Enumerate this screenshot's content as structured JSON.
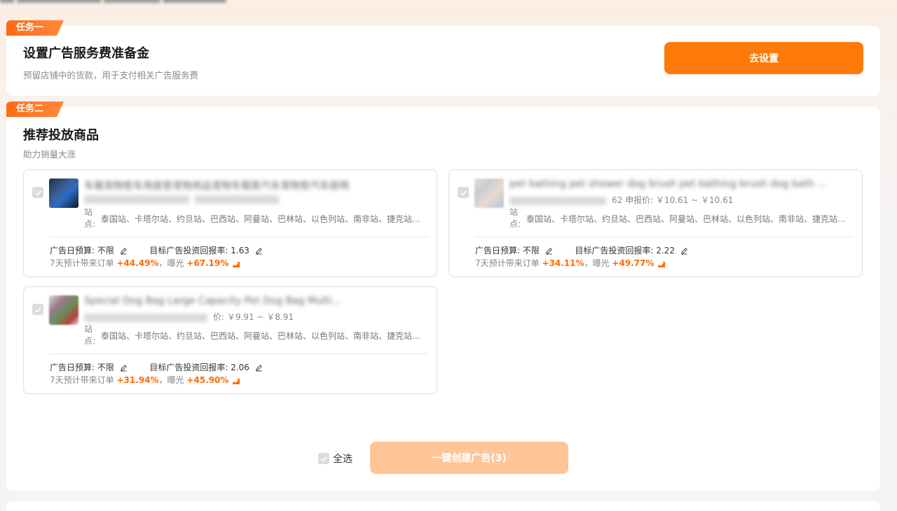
{
  "task1": {
    "ribbon": "任务一",
    "title": "设置广告服务费准备金",
    "subtitle": "预留店铺中的货款，用于支付相关广告服务费",
    "button_label": "去设置"
  },
  "task2": {
    "ribbon": "任务二",
    "title": "推荐投放商品",
    "subtitle": "助力销量大涨",
    "products": [
      {
        "title": "车载宠物垫车用座垫宠物用品宠物车载垫汽车宠物垫汽车座椅",
        "meta": "",
        "sites_label": "站点:",
        "sites": "泰国站、卡塔尔站、约旦站、巴西站、阿曼站、巴林站、以色列站、南非站、捷克站...",
        "budget_label": "广告日预算: 不限",
        "roi_label": "目标广告投资回报率: 1.63",
        "forecast_prefix": "7天预计带来订单",
        "orders_pct": "+44.49%",
        "forecast_mid": "，曝光",
        "exposure_pct": "+67.19%"
      },
      {
        "title": "pet bathing pet shower dog brush pet bathing brush dog bath ...",
        "meta": "62   申报价: ￥10.61 ~ ￥10.61",
        "sites_label": "站点:",
        "sites": "泰国站、卡塔尔站、约旦站、巴西站、阿曼站、巴林站、以色列站、南非站、捷克站...",
        "budget_label": "广告日预算: 不限",
        "roi_label": "目标广告投资回报率: 2.22",
        "forecast_prefix": "7天预计带来订单",
        "orders_pct": "+34.11%",
        "forecast_mid": "，曝光",
        "exposure_pct": "+49.77%"
      },
      {
        "title": "Special Dog Bag Large Capacity Pet Dog Bag Multi...",
        "meta": "价: ￥9.91 ~ ￥8.91",
        "sites_label": "站点:",
        "sites": "泰国站、卡塔尔站、约旦站、巴西站、阿曼站、巴林站、以色列站、南非站、捷克站...",
        "budget_label": "广告日预算: 不限",
        "roi_label": "目标广告投资回报率: 2.06",
        "forecast_prefix": "7天预计带来订单",
        "orders_pct": "+31.94%",
        "forecast_mid": "，曝光",
        "exposure_pct": "+45.90%"
      }
    ],
    "select_all_label": "全选",
    "create_button_label": "一键创建广告(3)"
  },
  "colors": {
    "accent": "#ff7a0a",
    "highlight": "#ff6a00",
    "disabled_button": "#ffc597"
  },
  "icons": [
    "check-icon",
    "edit-pencil-icon",
    "trend-up-icon"
  ]
}
